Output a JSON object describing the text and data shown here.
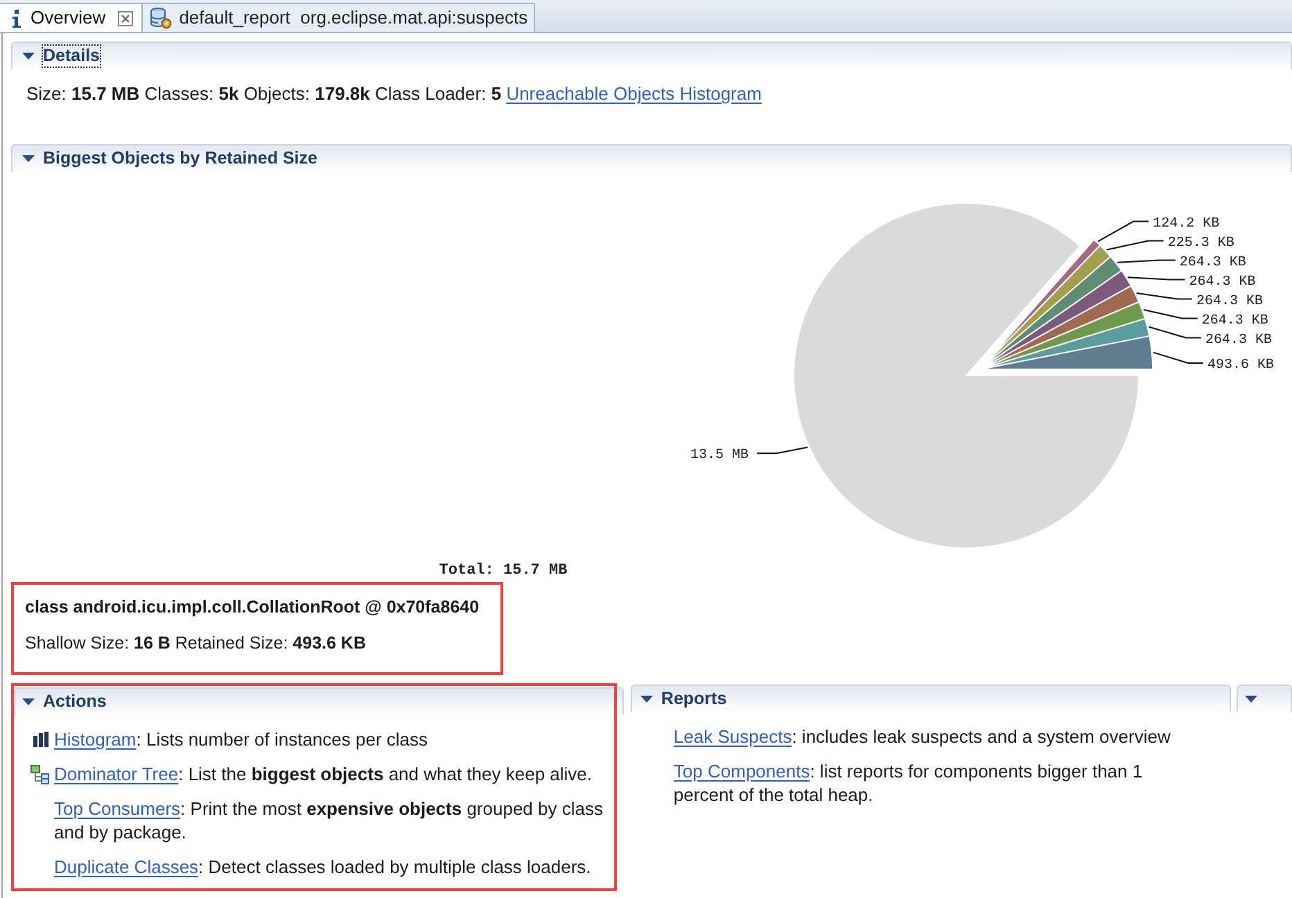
{
  "tabs": [
    {
      "label": "Overview",
      "closable": true,
      "selected": true
    },
    {
      "label": "default_report  org.eclipse.mat.api:suspects",
      "closable": false,
      "selected": false
    }
  ],
  "details": {
    "title": "Details",
    "expanded": true,
    "focused": true,
    "summary": "Size: **15.7 MB** Classes: **5k** Objects: **179.8k** Class Loader: **5**",
    "link": "Unreachable Objects Histogram"
  },
  "biggest_objects": {
    "title": "Biggest Objects by Retained Size",
    "expanded": true,
    "chart_data": {
      "type": "pie",
      "title": "Total: 15.7 MB",
      "categories": [
        "493.6 KB",
        "264.3 KB",
        "264.3 KB",
        "264.3 KB",
        "264.3 KB",
        "264.3 KB",
        "225.3 KB",
        "124.2 KB",
        "13.5 MB"
      ],
      "values": [
        493.6,
        264.3,
        264.3,
        264.3,
        264.3,
        264.3,
        225.3,
        124.2,
        13824
      ],
      "colors": [
        "#5f7d8e",
        "#5b9d9f",
        "#6f9a4e",
        "#a06a50",
        "#7d5a7d",
        "#5d8d72",
        "#a3a04c",
        "#a46b80",
        "#dadada"
      ]
    },
    "selection": {
      "title": "class android.icu.impl.coll.CollationRoot @ 0x70fa8640",
      "sizes": "Shallow Size: **16 B** Retained Size: **493.6 KB**"
    }
  },
  "actions": {
    "title": "Actions",
    "expanded": true,
    "items": [
      {
        "kind": "histogram",
        "link": "Histogram",
        "text": ": Lists number of instances per class"
      },
      {
        "kind": "tree",
        "link": "Dominator Tree",
        "text": ": List the **biggest objects** and what they keep alive."
      },
      {
        "kind": "none",
        "link": "Top Consumers",
        "text": ": Print the most **expensive objects** grouped by class and by package."
      },
      {
        "kind": "none",
        "link": "Duplicate Classes",
        "text": ": Detect classes loaded by multiple class loaders."
      }
    ]
  },
  "reports": {
    "title": "Reports",
    "expanded": true,
    "items": [
      {
        "link": "Leak Suspects",
        "text": ": includes leak suspects and a system overview"
      },
      {
        "link": "Top Components",
        "text": ": list reports for components bigger than 1 percent of the total heap."
      }
    ]
  },
  "panel_3": {
    "expanded": true
  }
}
